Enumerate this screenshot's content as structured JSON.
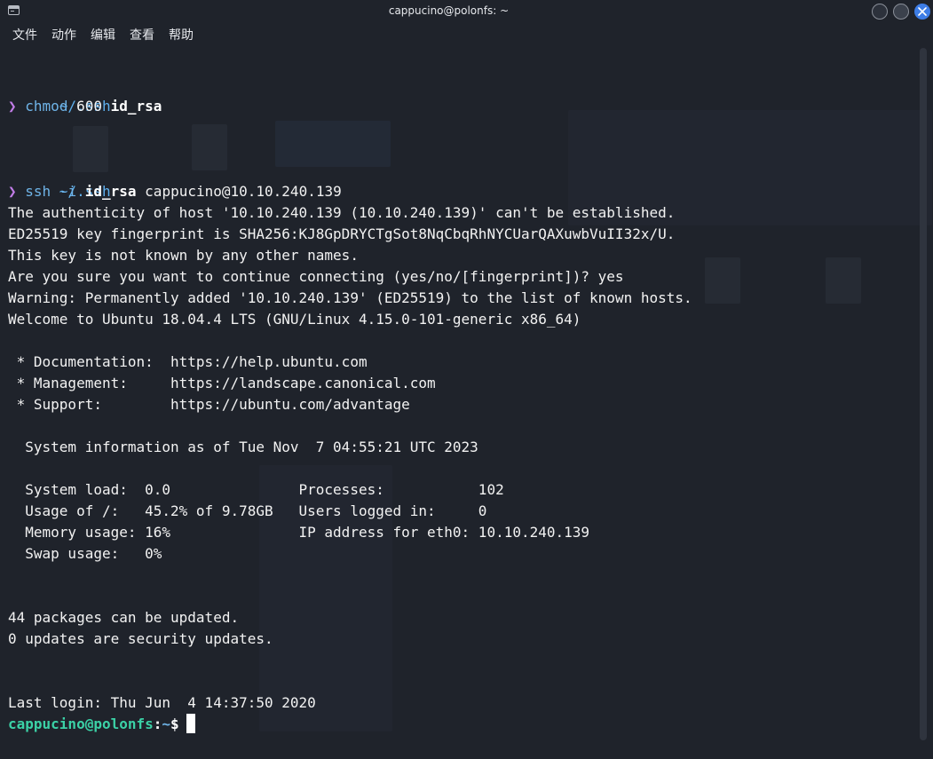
{
  "window": {
    "title": "cappucino@polonfs: ~"
  },
  "menu": {
    "file": "文件",
    "action": "动作",
    "edit": "编辑",
    "view": "查看",
    "help": "帮助"
  },
  "terminal": {
    "block1": {
      "path": "~/.ssh",
      "prompt_symbol": "❯",
      "cmd": "chmod",
      "arg1": "600",
      "arg2": "id_rsa"
    },
    "block2": {
      "path": "~/.ssh",
      "prompt_symbol": "❯",
      "cmd": "ssh",
      "flag": "-i",
      "key": "id_rsa",
      "target": "cappucino@10.10.240.139"
    },
    "output": [
      "The authenticity of host '10.10.240.139 (10.10.240.139)' can't be established.",
      "ED25519 key fingerprint is SHA256:KJ8GpDRYCTgSot8NqCbqRhNYCUarQAXuwbVuII32x/U.",
      "This key is not known by any other names.",
      "Are you sure you want to continue connecting (yes/no/[fingerprint])? yes",
      "Warning: Permanently added '10.10.240.139' (ED25519) to the list of known hosts.",
      "Welcome to Ubuntu 18.04.4 LTS (GNU/Linux 4.15.0-101-generic x86_64)",
      "",
      " * Documentation:  https://help.ubuntu.com",
      " * Management:     https://landscape.canonical.com",
      " * Support:        https://ubuntu.com/advantage",
      "",
      "  System information as of Tue Nov  7 04:55:21 UTC 2023",
      "",
      "  System load:  0.0               Processes:           102",
      "  Usage of /:   45.2% of 9.78GB   Users logged in:     0",
      "  Memory usage: 16%               IP address for eth0: 10.10.240.139",
      "  Swap usage:   0%",
      "",
      "",
      "44 packages can be updated.",
      "0 updates are security updates.",
      "",
      "",
      "Last login: Thu Jun  4 14:37:50 2020"
    ],
    "final_prompt": {
      "user_host": "cappucino@polonfs",
      "colon": ":",
      "path": "~",
      "dollar": "$"
    }
  },
  "colors": {
    "background": "#1f232b",
    "path": "#5fb0ee",
    "prompt_symbol": "#c27de8",
    "command": "#6fb4e8",
    "user_host": "#3bd1a6",
    "close_button": "#3d7de6"
  }
}
